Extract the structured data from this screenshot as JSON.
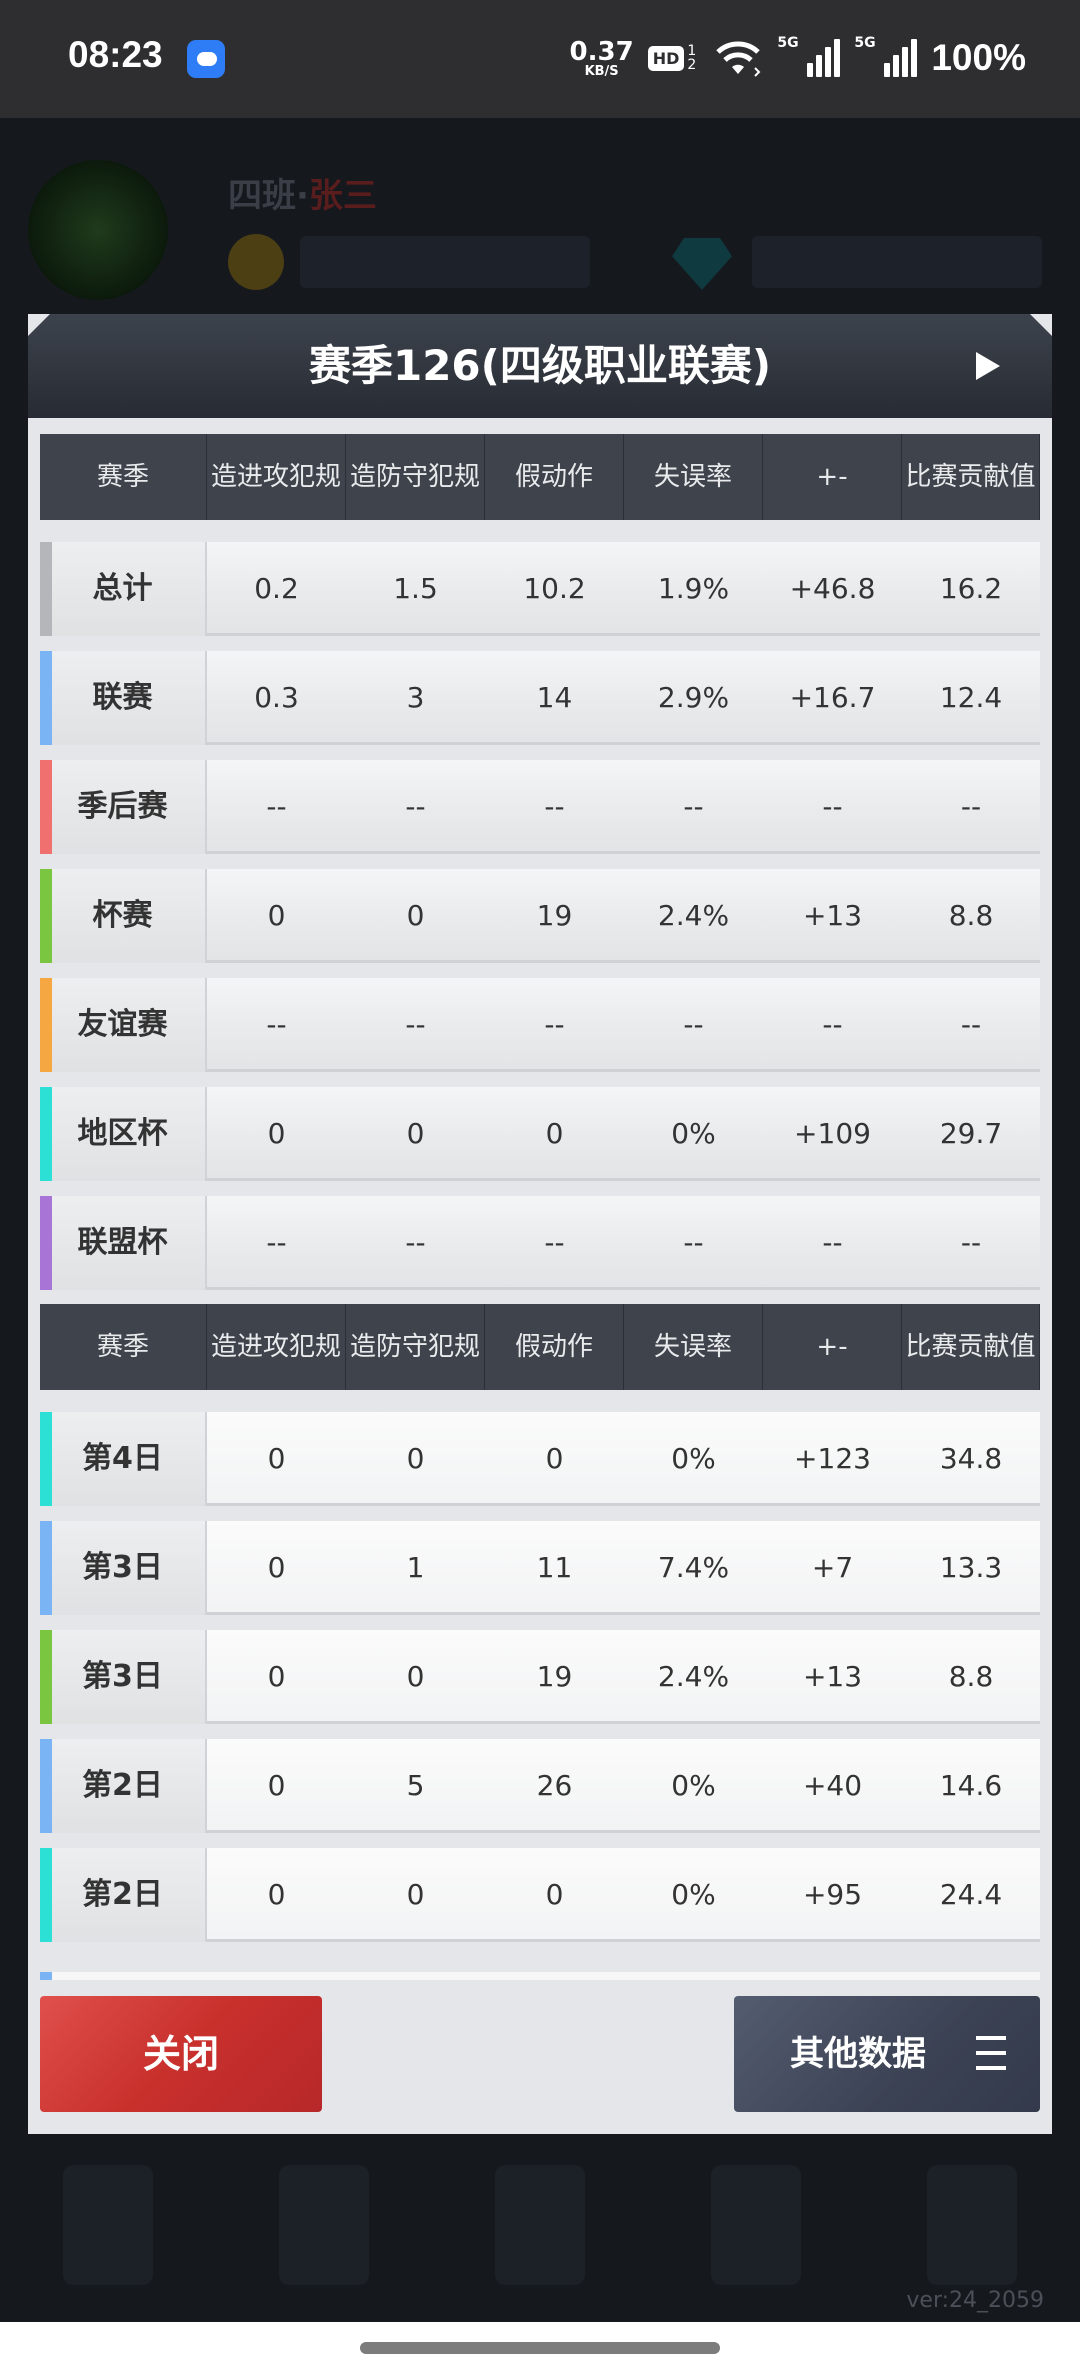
{
  "status_bar": {
    "time": "08:23",
    "net_speed": "0.37",
    "net_unit": "KB/S",
    "hd": "HD",
    "hd_sub": "1 2",
    "signal1": "5G",
    "signal2": "5G",
    "battery": "100%"
  },
  "background": {
    "player_name_prefix": "四班·",
    "player_name_suffix": "张三",
    "version": "ver:24_2059"
  },
  "modal": {
    "title": "赛季126(四级职业联赛)",
    "columns": [
      "赛季",
      "造进攻犯规",
      "造防守犯规",
      "假动作",
      "失误率",
      "+-",
      "比赛贡献值"
    ],
    "summary_rows": [
      {
        "label": "总计",
        "stripe": "#b4b6b9",
        "values": [
          "0.2",
          "1.5",
          "10.2",
          "1.9%",
          "+46.8",
          "16.2"
        ]
      },
      {
        "label": "联赛",
        "stripe": "#7ab4f5",
        "values": [
          "0.3",
          "3",
          "14",
          "2.9%",
          "+16.7",
          "12.4"
        ]
      },
      {
        "label": "季后赛",
        "stripe": "#f06f6f",
        "values": [
          "--",
          "--",
          "--",
          "--",
          "--",
          "--"
        ]
      },
      {
        "label": "杯赛",
        "stripe": "#7ac641",
        "values": [
          "0",
          "0",
          "19",
          "2.4%",
          "+13",
          "8.8"
        ]
      },
      {
        "label": "友谊赛",
        "stripe": "#f5a742",
        "values": [
          "--",
          "--",
          "--",
          "--",
          "--",
          "--"
        ]
      },
      {
        "label": "地区杯",
        "stripe": "#2ce0d6",
        "values": [
          "0",
          "0",
          "0",
          "0%",
          "+109",
          "29.7"
        ]
      },
      {
        "label": "联盟杯",
        "stripe": "#a874d6",
        "values": [
          "--",
          "--",
          "--",
          "--",
          "--",
          "--"
        ]
      }
    ],
    "daily_rows": [
      {
        "label": "第4日",
        "stripe": "#2ce0d6",
        "values": [
          "0",
          "0",
          "0",
          "0%",
          "+123",
          "34.8"
        ]
      },
      {
        "label": "第3日",
        "stripe": "#7ab4f5",
        "values": [
          "0",
          "1",
          "11",
          "7.4%",
          "+7",
          "13.3"
        ]
      },
      {
        "label": "第3日",
        "stripe": "#7ac641",
        "values": [
          "0",
          "0",
          "19",
          "2.4%",
          "+13",
          "8.8"
        ]
      },
      {
        "label": "第2日",
        "stripe": "#7ab4f5",
        "values": [
          "0",
          "5",
          "26",
          "0%",
          "+40",
          "14.6"
        ]
      },
      {
        "label": "第2日",
        "stripe": "#2ce0d6",
        "values": [
          "0",
          "0",
          "0",
          "0%",
          "+95",
          "24.4"
        ]
      }
    ],
    "close_button": "关闭",
    "other_data_button": "其他数据"
  }
}
